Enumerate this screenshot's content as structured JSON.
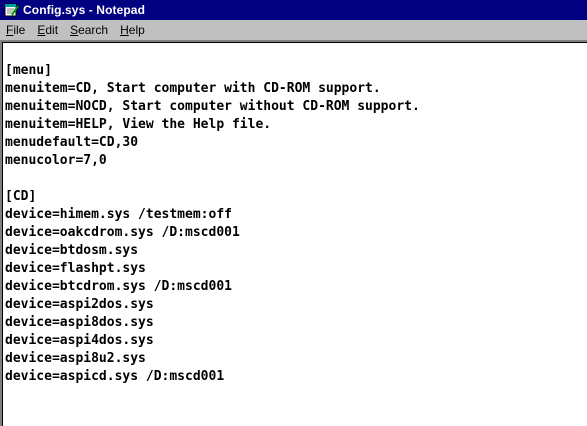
{
  "window": {
    "title": "Config.sys - Notepad",
    "icon": "notepad-icon"
  },
  "colors": {
    "titlebar": "#000080",
    "title_text": "#ffffff",
    "menubar": "#c0c0c0",
    "editor_bg": "#ffffff",
    "text": "#000000"
  },
  "menu": {
    "items": [
      {
        "accel": "F",
        "rest": "ile"
      },
      {
        "accel": "E",
        "rest": "dit"
      },
      {
        "accel": "S",
        "rest": "earch"
      },
      {
        "accel": "H",
        "rest": "elp"
      }
    ]
  },
  "document": {
    "lines": [
      "[menu]",
      "menuitem=CD, Start computer with CD-ROM support.",
      "menuitem=NOCD, Start computer without CD-ROM support.",
      "menuitem=HELP, View the Help file.",
      "menudefault=CD,30",
      "menucolor=7,0",
      "",
      "[CD]",
      "device=himem.sys /testmem:off",
      "device=oakcdrom.sys /D:mscd001",
      "device=btdosm.sys",
      "device=flashpt.sys",
      "device=btcdrom.sys /D:mscd001",
      "device=aspi2dos.sys",
      "device=aspi8dos.sys",
      "device=aspi4dos.sys",
      "device=aspi8u2.sys",
      "device=aspicd.sys /D:mscd001"
    ]
  }
}
